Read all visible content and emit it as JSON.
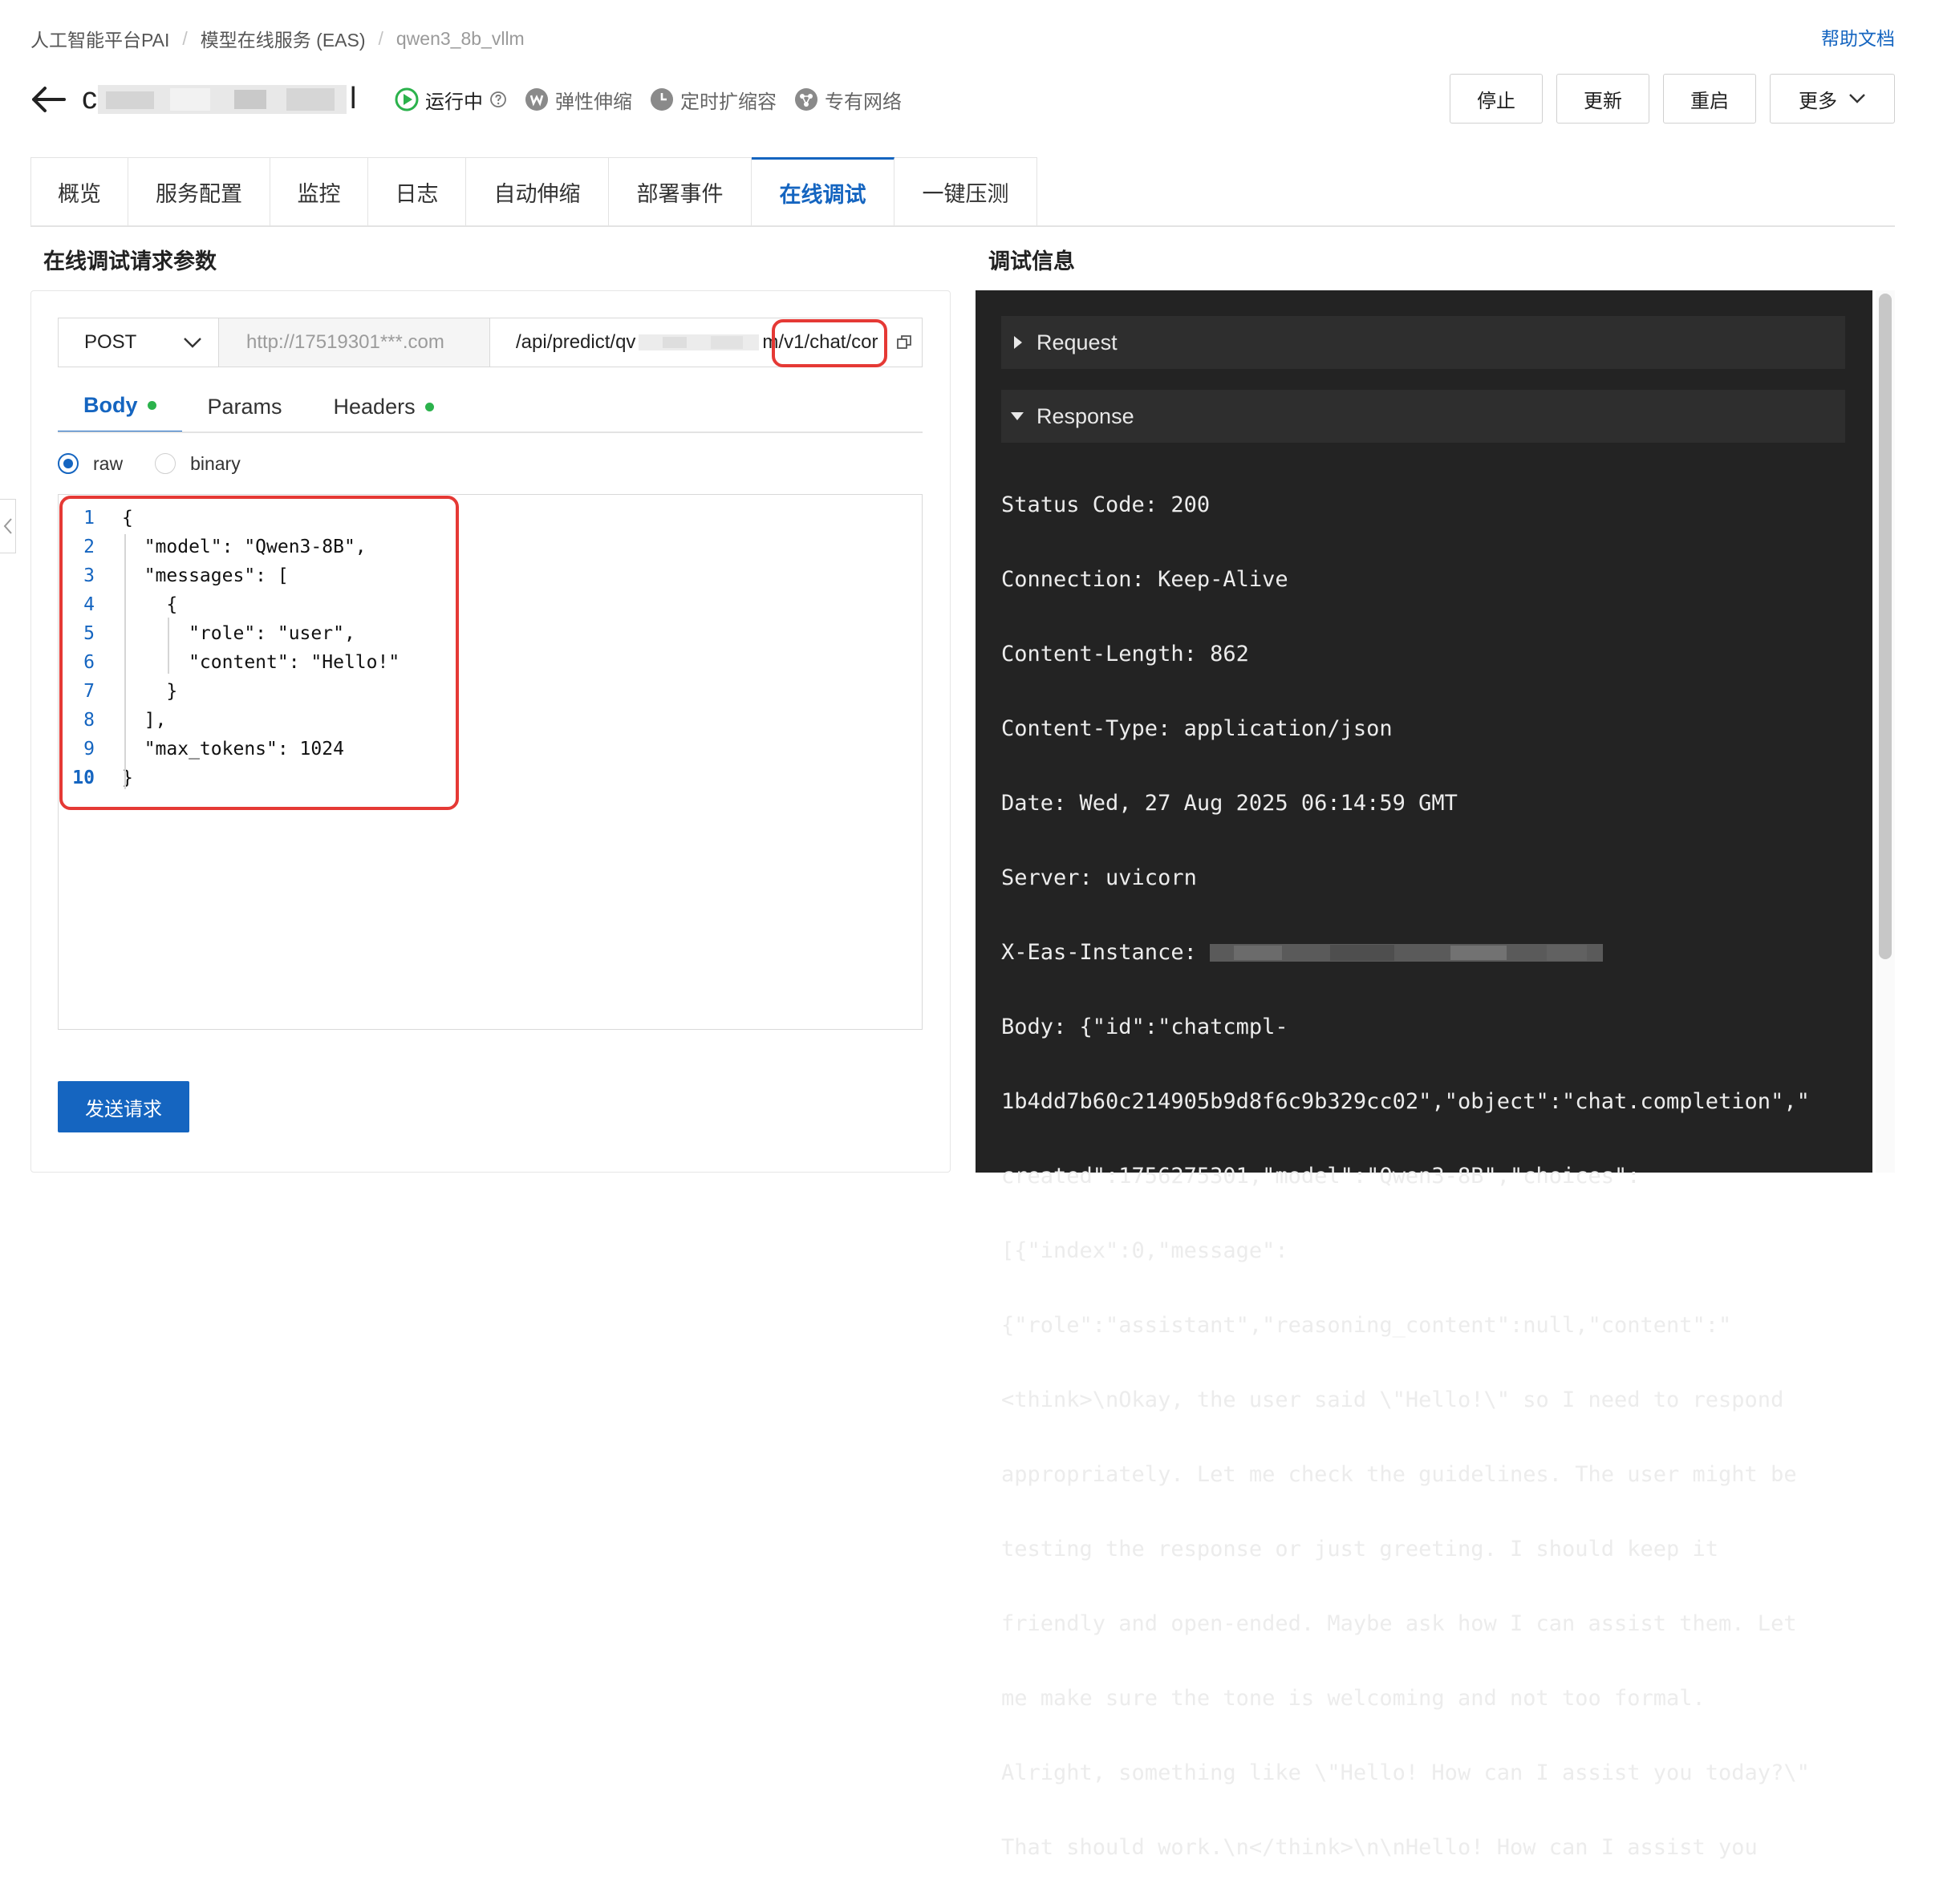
{
  "breadcrumb": {
    "items": [
      "人工智能平台PAI",
      "模型在线服务 (EAS)"
    ],
    "current": "qwen3_8b_vllm",
    "separator": "/"
  },
  "help_link": "帮助文档",
  "title": {
    "visible_prefix": "c",
    "visible_suffix": "l"
  },
  "status": {
    "running": "运行中",
    "elastic": "弹性伸缩",
    "scheduled": "定时扩缩容",
    "vpc": "专有网络"
  },
  "actions": {
    "stop": "停止",
    "update": "更新",
    "restart": "重启",
    "more": "更多"
  },
  "tabs": [
    "概览",
    "服务配置",
    "监控",
    "日志",
    "自动伸缩",
    "部署事件",
    "在线调试",
    "一键压测"
  ],
  "active_tab": "在线调试",
  "left": {
    "title": "在线调试请求参数",
    "method": "POST",
    "host": "http://17519301***.com",
    "path_prefix": "/api/predict/qv",
    "path_suffix_a": "m/",
    "path_suffix_b": "v1/chat/cor",
    "subtabs": {
      "body": "Body",
      "params": "Params",
      "headers": "Headers"
    },
    "radio": {
      "raw": "raw",
      "binary": "binary"
    },
    "line_numbers": [
      "1",
      "2",
      "3",
      "4",
      "5",
      "6",
      "7",
      "8",
      "9",
      "10"
    ],
    "code_lines": [
      "{",
      "  \"model\": \"Qwen3-8B\",",
      "  \"messages\": [",
      "    {",
      "      \"role\": \"user\",",
      "      \"content\": \"Hello!\"",
      "    }",
      "  ],",
      "  \"max_tokens\": 1024",
      "}"
    ],
    "send": "发送请求"
  },
  "right": {
    "title": "调试信息",
    "request_label": "Request",
    "response_label": "Response",
    "lines": [
      "Status Code: 200",
      "Connection: Keep-Alive",
      "Content-Length: 862",
      "Content-Type: application/json",
      "Date: Wed, 27 Aug 2025 06:14:59 GMT",
      "Server: uvicorn",
      "X-Eas-Instance: ",
      "Body: {\"id\":\"chatcmpl-",
      "1b4dd7b60c214905b9d8f6c9b329cc02\",\"object\":\"chat.completion\",\"",
      "created\":1756275301,\"model\":\"Qwen3-8B\",\"choices\":",
      "[{\"index\":0,\"message\":",
      "{\"role\":\"assistant\",\"reasoning_content\":null,\"content\":\"",
      "<think>\\nOkay, the user said \\\"Hello!\\\" so I need to respond",
      "appropriately. Let me check the guidelines. The user might be",
      "testing the response or just greeting. I should keep it",
      "friendly and open-ended. Maybe ask how I can assist them. Let",
      "me make sure the tone is welcoming and not too formal.",
      "Alright, something like \\\"Hello! How can I assist you today?\\\"",
      "That should work.\\n</think>\\n\\nHello! How can I assist you"
    ]
  },
  "colors": {
    "accent": "#1565c0",
    "highlight": "#e53935",
    "running": "#2bb24c",
    "console_bg": "#232323"
  }
}
